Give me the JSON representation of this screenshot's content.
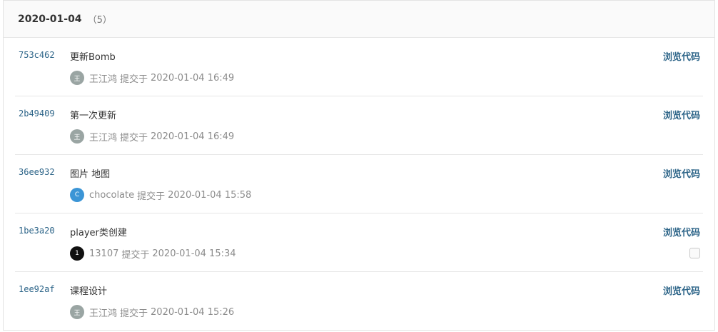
{
  "group": {
    "date": "2020-01-04",
    "count": "（5）"
  },
  "commits": [
    {
      "sha": "753c462",
      "title": "更新Bomb",
      "author": "王江鸿",
      "avatar_text": "王",
      "avatar_color": "#9aa5a3",
      "committed_label": "提交于",
      "time": "2020-01-04 16:49",
      "browse_label": "浏览代码"
    },
    {
      "sha": "2b49409",
      "title": "第一次更新",
      "author": "王江鸿",
      "avatar_text": "王",
      "avatar_color": "#9aa5a3",
      "committed_label": "提交于",
      "time": "2020-01-04 16:49",
      "browse_label": "浏览代码"
    },
    {
      "sha": "36ee932",
      "title": "图片 地图",
      "author": "chocolate",
      "avatar_text": "C",
      "avatar_color": "#3b95d6",
      "committed_label": "提交于",
      "time": "2020-01-04 15:58",
      "browse_label": "浏览代码"
    },
    {
      "sha": "1be3a20",
      "title": "player类创建",
      "author": "13107",
      "avatar_text": "1",
      "avatar_color": "#111111",
      "committed_label": "提交于",
      "time": "2020-01-04 15:34",
      "browse_label": "浏览代码"
    },
    {
      "sha": "1ee92af",
      "title": "课程设计",
      "author": "王江鸿",
      "avatar_text": "王",
      "avatar_color": "#9aa5a3",
      "committed_label": "提交于",
      "time": "2020-01-04 15:26",
      "browse_label": "浏览代码"
    }
  ]
}
